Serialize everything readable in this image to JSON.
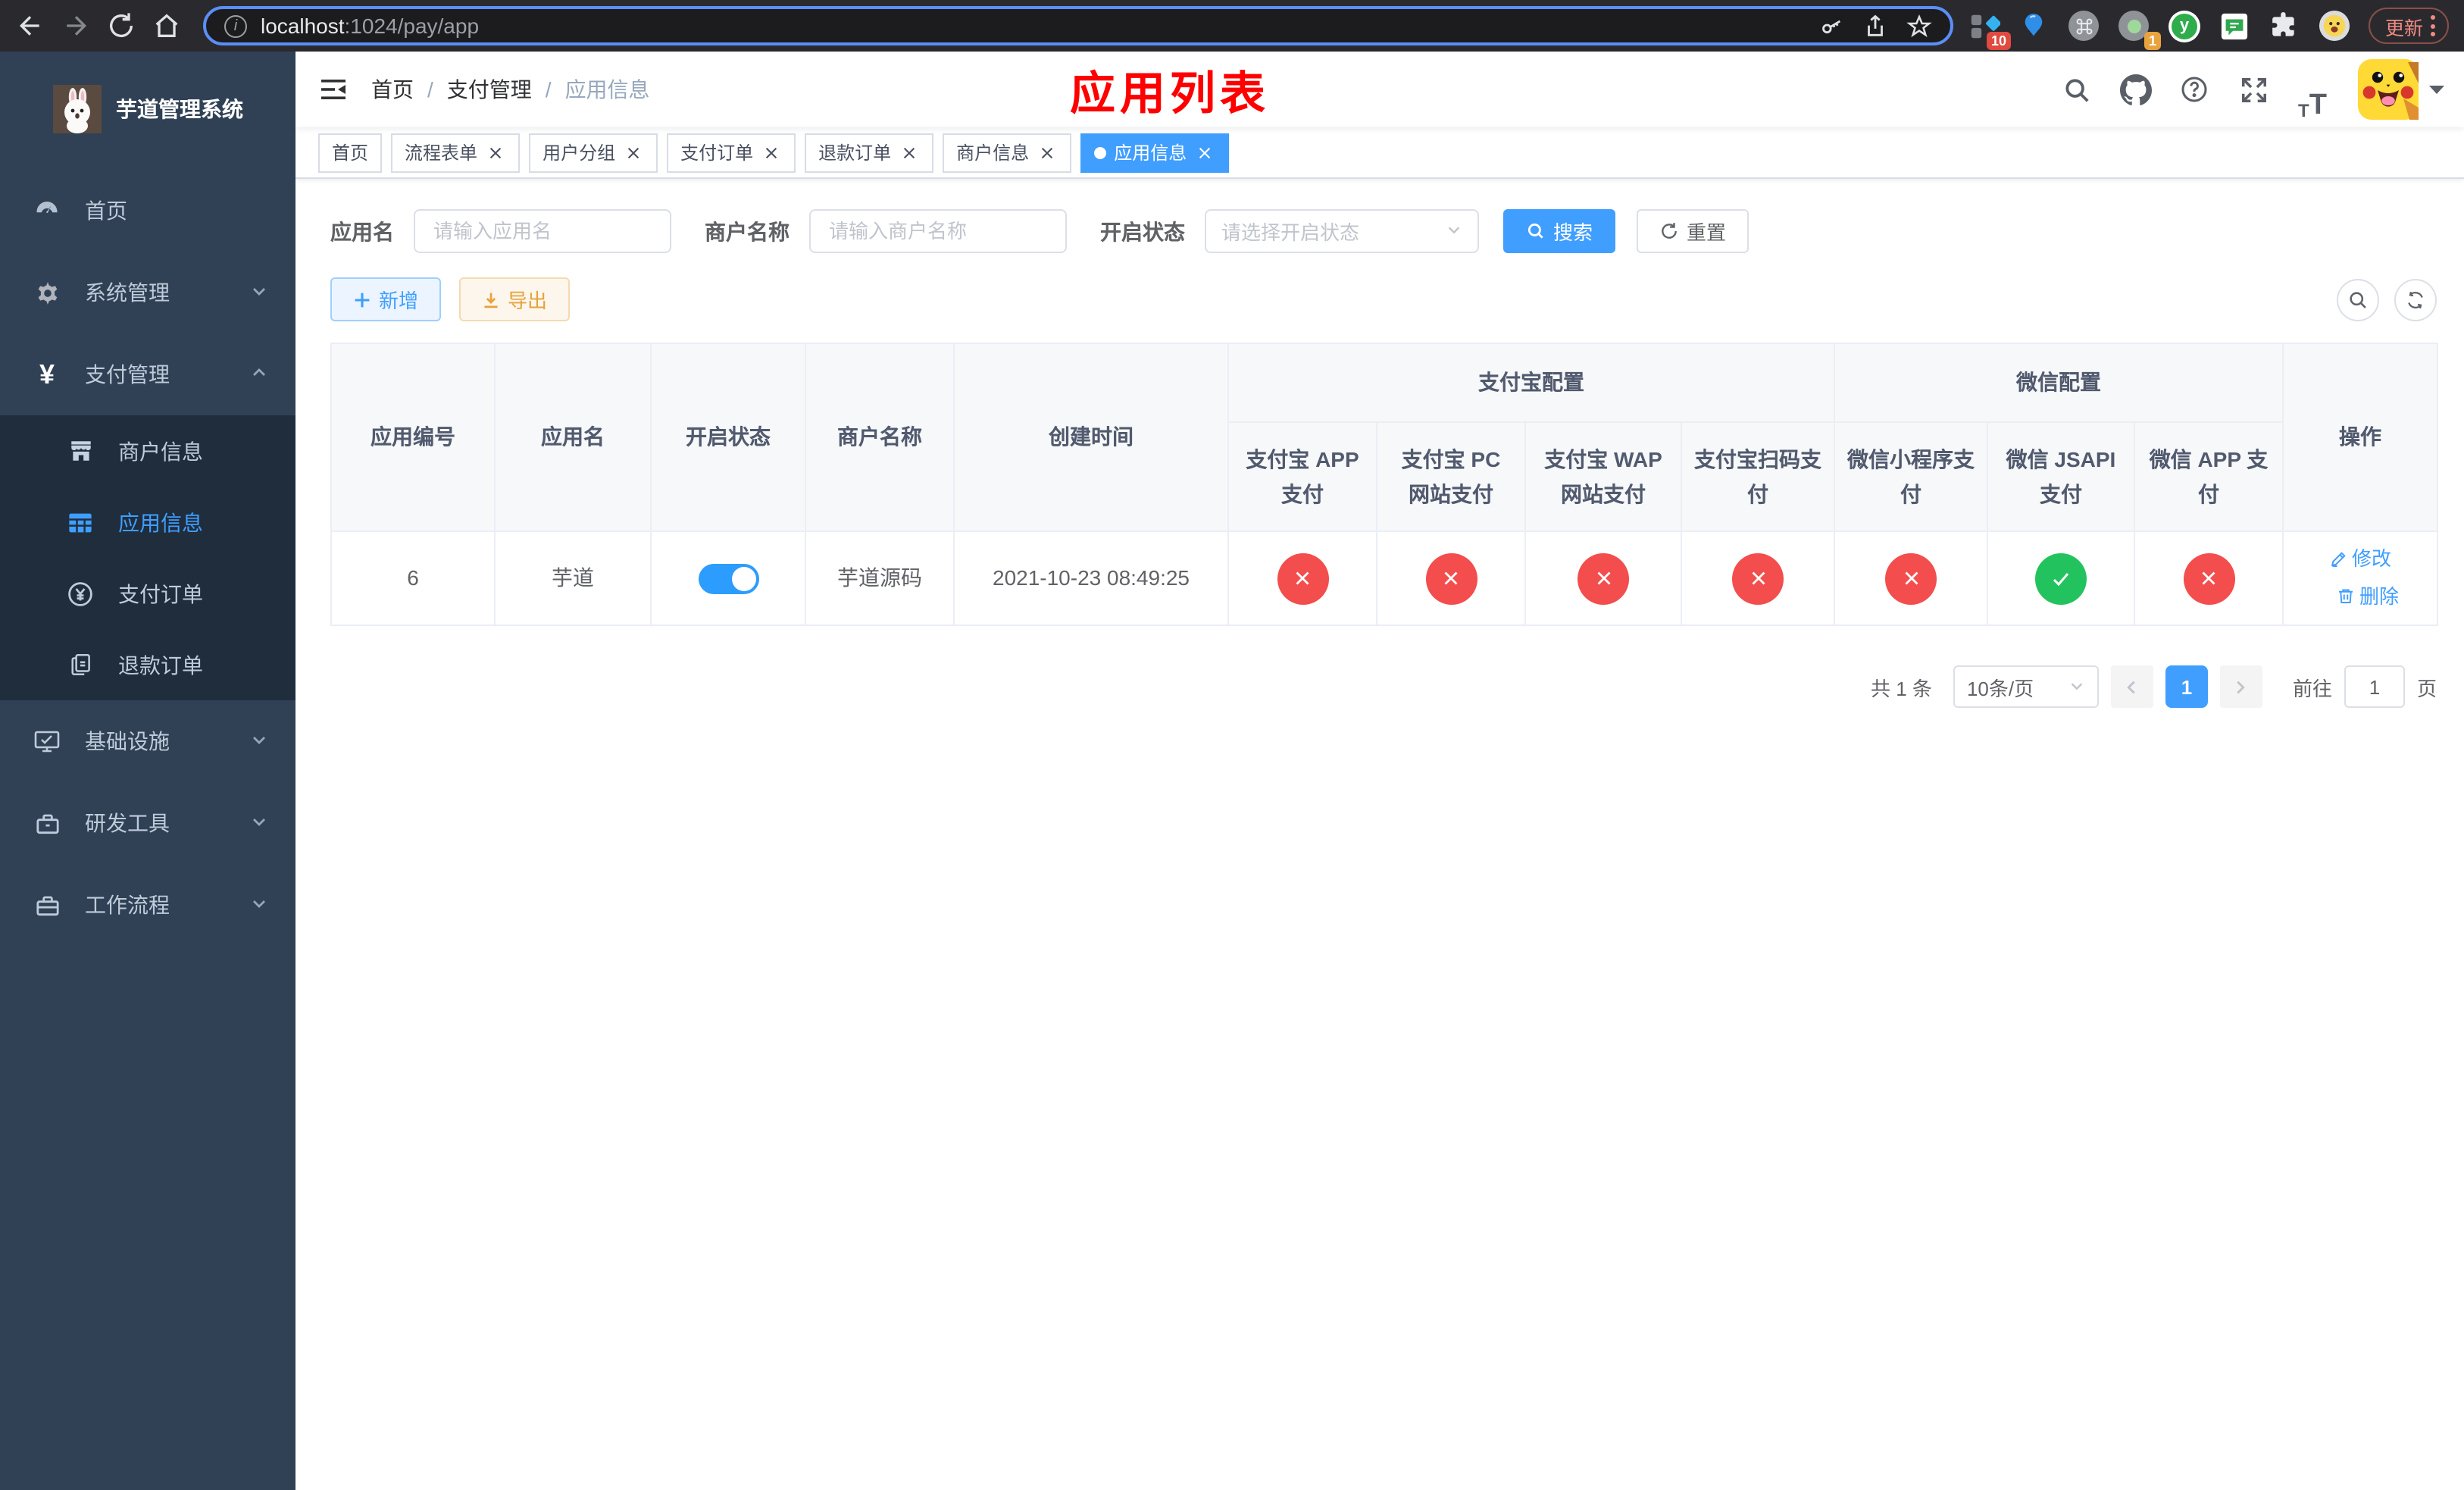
{
  "browser": {
    "url": {
      "host": "localhost",
      "path": ":1024/pay/app"
    },
    "update_button": "更新",
    "extension_badges": {
      "apps": "10",
      "tab_counter": "1"
    }
  },
  "icons": {
    "yuan": "¥",
    "question": "?",
    "info": "i",
    "y_logo": "y",
    "font_large": "T",
    "font_small": "T"
  },
  "sidebar": {
    "title": "芋道管理系统",
    "menu": [
      {
        "label": "首页"
      },
      {
        "label": "系统管理"
      },
      {
        "label": "支付管理"
      },
      {
        "label": "商户信息"
      },
      {
        "label": "应用信息"
      },
      {
        "label": "支付订单"
      },
      {
        "label": "退款订单"
      },
      {
        "label": "基础设施"
      },
      {
        "label": "研发工具"
      },
      {
        "label": "工作流程"
      }
    ]
  },
  "navbar": {
    "breadcrumb": [
      "首页",
      "支付管理",
      "应用信息"
    ],
    "page_title": "应用列表"
  },
  "tags": [
    {
      "label": "首页"
    },
    {
      "label": "流程表单"
    },
    {
      "label": "用户分组"
    },
    {
      "label": "支付订单"
    },
    {
      "label": "退款订单"
    },
    {
      "label": "商户信息"
    },
    {
      "label": "应用信息"
    }
  ],
  "filters": {
    "app_name_label": "应用名",
    "app_name_placeholder": "请输入应用名",
    "merchant_label": "商户名称",
    "merchant_placeholder": "请输入商户名称",
    "status_label": "开启状态",
    "status_placeholder": "请选择开启状态",
    "search_button": "搜索",
    "reset_button": "重置"
  },
  "toolbar": {
    "add_button": "新增",
    "export_button": "导出"
  },
  "table": {
    "group_headers": {
      "alipay": "支付宝配置",
      "wechat": "微信配置"
    },
    "columns": [
      "应用编号",
      "应用名",
      "开启状态",
      "商户名称",
      "创建时间",
      "支付宝 APP 支付",
      "支付宝 PC 网站支付",
      "支付宝 WAP 网站支付",
      "支付宝扫码支付",
      "微信小程序支付",
      "微信 JSAPI 支付",
      "微信 APP 支付",
      "操作"
    ],
    "rows": [
      {
        "id": "6",
        "name": "芋道",
        "enabled": true,
        "merchant": "芋道源码",
        "created": "2021-10-23 08:49:25",
        "channels": [
          "no",
          "no",
          "no",
          "no",
          "no",
          "yes",
          "no"
        ],
        "edit_label": "修改",
        "delete_label": "删除"
      }
    ]
  },
  "pagination": {
    "total": "共 1 条",
    "page_size": "10条/页",
    "current_page": "1",
    "goto_label": "前往",
    "goto_value": "1",
    "goto_suffix": "页"
  },
  "colors": {
    "accent": "#409eff",
    "danger": "#f34d4d",
    "success": "#22c35e",
    "sidebar_bg": "#304156",
    "submenu_bg": "#1f2d3d",
    "title_red": "#ff0000",
    "warning": "#e6a23c"
  }
}
